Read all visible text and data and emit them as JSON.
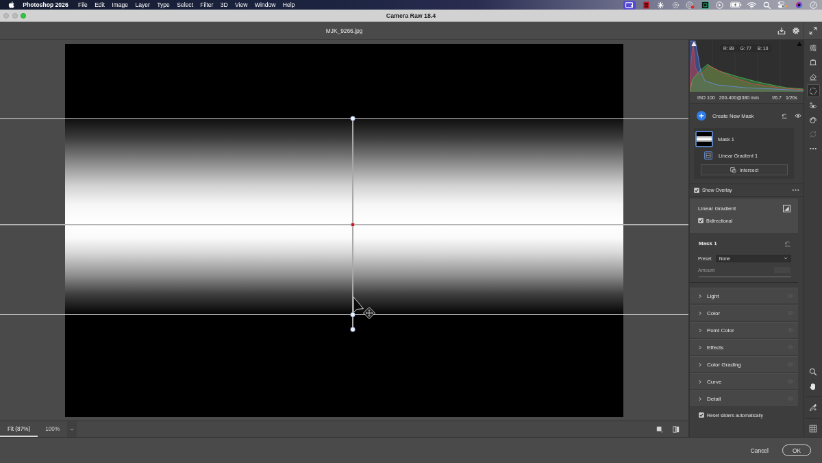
{
  "menu_bar": {
    "app_name": "Photoshop 2026",
    "menus": [
      "File",
      "Edit",
      "Image",
      "Layer",
      "Type",
      "Select",
      "Filter",
      "3D",
      "View",
      "Window",
      "Help"
    ]
  },
  "window": {
    "title": "Camera Raw 18.4"
  },
  "toolbar": {
    "filename": "MJK_9266.jpg"
  },
  "histogram": {
    "readout": [
      "R: 89",
      "G: 77",
      "B: 10"
    ]
  },
  "camera_info": [
    "ISO 100",
    "200-400@380 mm",
    "f/6.7",
    "1/20s"
  ],
  "masking": {
    "create_label": "Create New Mask",
    "masks": [
      {
        "name": "Mask 1",
        "selected": true,
        "components": [
          {
            "name": "Linear Gradient 1",
            "selected": true
          }
        ]
      }
    ],
    "intersect_label": "Intersect",
    "show_overlay": {
      "label": "Show Overlay",
      "checked": true
    }
  },
  "linear_gradient": {
    "title": "Linear Gradient",
    "bidirectional": {
      "label": "Bidirectional",
      "checked": true
    }
  },
  "mask_settings": {
    "title": "Mask 1",
    "preset": {
      "label": "Preset",
      "value": "None"
    },
    "amount": {
      "label": "Amount",
      "disabled": true
    }
  },
  "sections": [
    {
      "label": "Light",
      "expanded": false
    },
    {
      "label": "Color",
      "expanded": false
    },
    {
      "label": "Point Color",
      "expanded": false
    },
    {
      "label": "Effects",
      "expanded": false
    },
    {
      "label": "Color Grading",
      "expanded": false
    },
    {
      "label": "Curve",
      "expanded": false
    },
    {
      "label": "Detail",
      "expanded": false
    }
  ],
  "reset_sliders": {
    "label": "Reset sliders automatically",
    "checked": true
  },
  "tools": [
    {
      "kind": "edit",
      "selected": false,
      "disabled": false
    },
    {
      "kind": "crop",
      "selected": false,
      "disabled": false
    },
    {
      "kind": "remove",
      "selected": false,
      "disabled": false
    },
    {
      "kind": "masking",
      "selected": true,
      "disabled": false
    },
    {
      "kind": "red-eye",
      "selected": false,
      "disabled": false
    },
    {
      "kind": "presets",
      "selected": false,
      "disabled": false
    },
    {
      "kind": "snapshots",
      "selected": false,
      "disabled": true
    },
    {
      "kind": "more",
      "selected": false,
      "disabled": false
    }
  ],
  "zoom_options": [
    {
      "label": "Fit (87%)",
      "selected": true
    },
    {
      "label": "100%",
      "selected": false
    }
  ],
  "footer_buttons": [
    {
      "label": "Cancel",
      "kind": "text"
    },
    {
      "label": "OK",
      "kind": "outlined"
    }
  ]
}
